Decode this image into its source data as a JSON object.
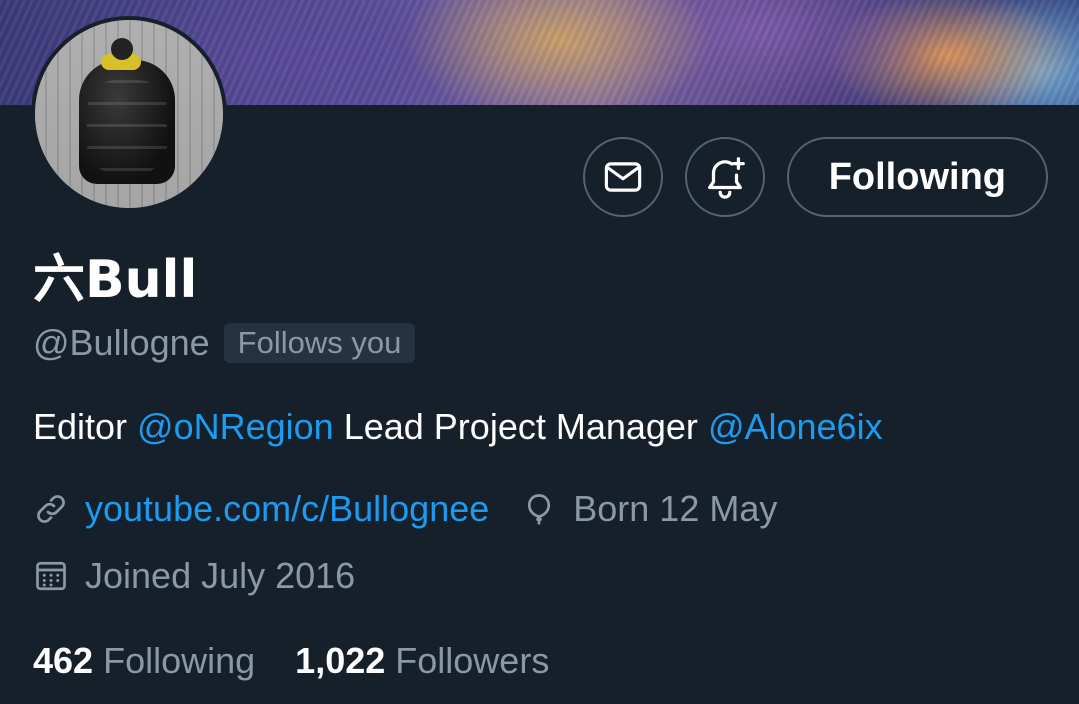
{
  "profile": {
    "display_name": "六Bull",
    "handle": "@Bullogne",
    "follows_you_badge": "Follows you",
    "bio": {
      "t1": "Editor ",
      "m1": "@oNRegion",
      "t2": " Lead Project Manager ",
      "m2": "@Alone6ix"
    },
    "website": "youtube.com/c/Bullognee",
    "birthday": "Born 12 May",
    "joined": "Joined July 2016"
  },
  "actions": {
    "message_icon": "envelope-icon",
    "notify_icon": "bell-plus-icon",
    "follow_label": "Following"
  },
  "stats": {
    "following_count": "462",
    "following_label": "Following",
    "followers_count": "1,022",
    "followers_label": "Followers"
  },
  "icons": {
    "link": "link-icon",
    "birthday": "balloon-icon",
    "joined": "calendar-icon"
  },
  "colors": {
    "background": "#15202b",
    "accent": "#1d9bf0",
    "secondary_text": "#8b98a5",
    "border": "#536471"
  }
}
